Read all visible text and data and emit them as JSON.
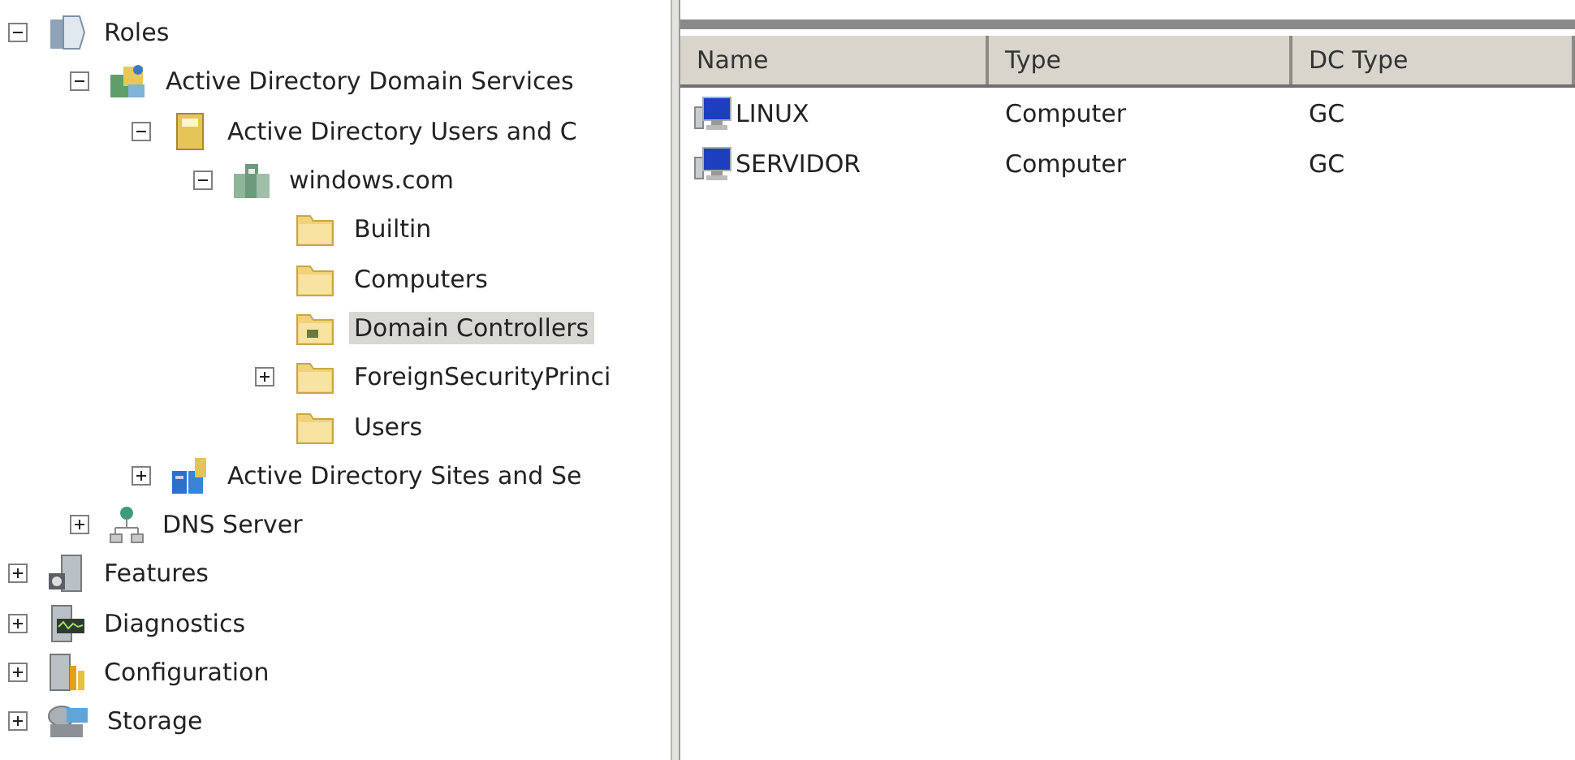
{
  "tree": [
    {
      "label": "Roles",
      "kind": "roles",
      "expanded": true,
      "selected": false,
      "children": [
        {
          "label": "Active Directory Domain Services",
          "kind": "adds",
          "expanded": true,
          "selected": false,
          "children": [
            {
              "label": "Active Directory Users and C",
              "kind": "aduc",
              "expanded": true,
              "selected": false,
              "children": [
                {
                  "label": "windows.com",
                  "kind": "domain",
                  "expanded": true,
                  "selected": false,
                  "children": [
                    {
                      "label": "Builtin",
                      "kind": "folder",
                      "selected": false
                    },
                    {
                      "label": "Computers",
                      "kind": "folder",
                      "selected": false
                    },
                    {
                      "label": "Domain Controllers",
                      "kind": "folder-dc",
                      "selected": true
                    },
                    {
                      "label": "ForeignSecurityPrinci",
                      "kind": "folder",
                      "expanded": false,
                      "selected": false
                    },
                    {
                      "label": "Users",
                      "kind": "folder",
                      "selected": false
                    }
                  ]
                }
              ]
            },
            {
              "label": "Active Directory Sites and Se",
              "kind": "sites",
              "expanded": false,
              "selected": false
            }
          ]
        },
        {
          "label": "DNS Server",
          "kind": "dns",
          "expanded": false,
          "selected": false
        }
      ]
    },
    {
      "label": "Features",
      "kind": "features",
      "expanded": false,
      "selected": false
    },
    {
      "label": "Diagnostics",
      "kind": "diagnostics",
      "expanded": false,
      "selected": false
    },
    {
      "label": "Configuration",
      "kind": "configuration",
      "expanded": false,
      "selected": false
    },
    {
      "label": "Storage",
      "kind": "storage",
      "expanded": false,
      "selected": false
    }
  ],
  "list": {
    "columns": [
      "Name",
      "Type",
      "DC Type"
    ],
    "rows": [
      {
        "cells": [
          "LINUX",
          "Computer",
          "GC"
        ]
      },
      {
        "cells": [
          "SERVIDOR",
          "Computer",
          "GC"
        ]
      }
    ]
  }
}
